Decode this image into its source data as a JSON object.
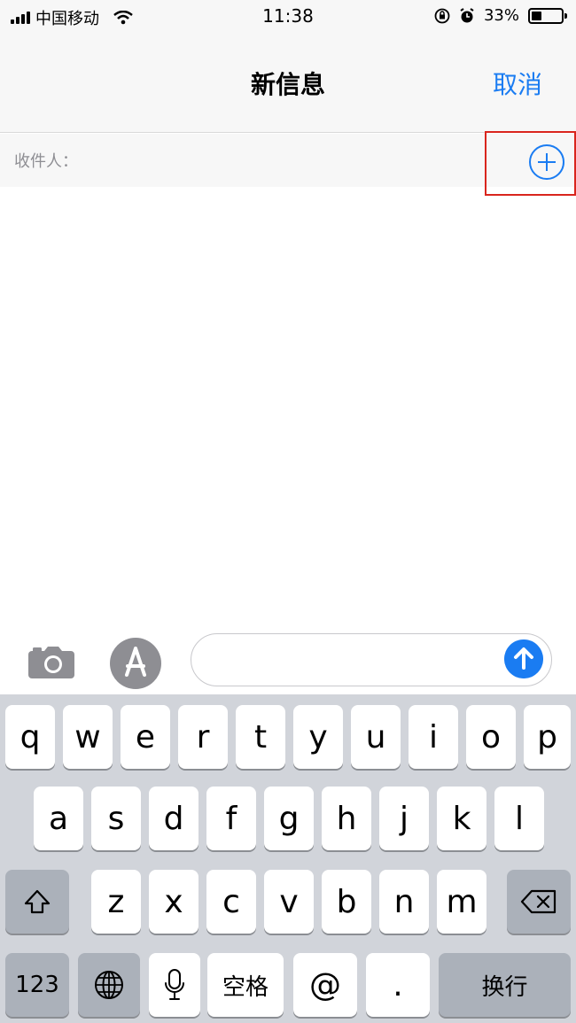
{
  "status_bar": {
    "carrier": "中国移动",
    "time": "11:38",
    "battery_percent": "33%",
    "battery_level": 0.33
  },
  "nav": {
    "title": "新信息",
    "cancel_label": "取消"
  },
  "recipient": {
    "label": "收件人："
  },
  "keyboard": {
    "row1": [
      "q",
      "w",
      "e",
      "r",
      "t",
      "y",
      "u",
      "i",
      "o",
      "p"
    ],
    "row2": [
      "a",
      "s",
      "d",
      "f",
      "g",
      "h",
      "j",
      "k",
      "l"
    ],
    "row3": [
      "z",
      "x",
      "c",
      "v",
      "b",
      "n",
      "m"
    ],
    "numbers_label": "123",
    "space_label": "空格",
    "at_label": "@",
    "dot_label": ".",
    "return_label": "换行"
  },
  "icons": {
    "add_contact": "plus-circle-icon",
    "camera": "camera-icon",
    "apps": "app-store-icon",
    "send": "arrow-up-icon",
    "shift": "shift-icon",
    "delete": "delete-icon",
    "globe": "globe-icon",
    "mic": "microphone-icon"
  },
  "colors": {
    "accent": "#1a7cf2",
    "highlight": "#d9251d",
    "keyboard_bg": "#d1d4da"
  }
}
